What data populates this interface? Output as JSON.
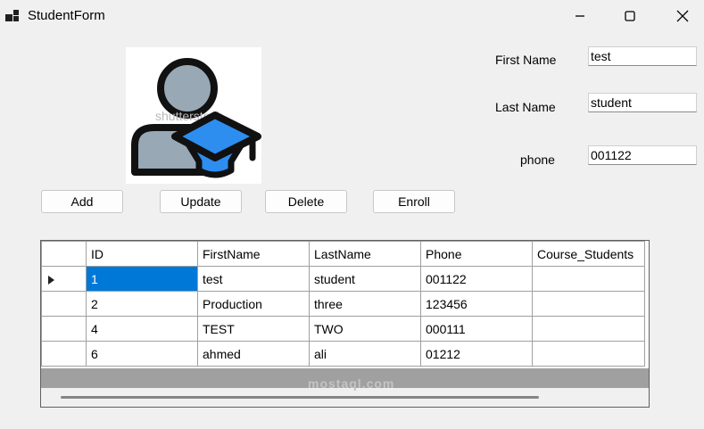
{
  "window": {
    "title": "StudentForm"
  },
  "photo": {
    "icon": "student-graduate-icon",
    "watermark": "shutterstock"
  },
  "form": {
    "first_name_label": "First Name",
    "first_name_value": "test",
    "last_name_label": "Last Name",
    "last_name_value": "student",
    "phone_label": "phone",
    "phone_value": "001122"
  },
  "buttons": {
    "add": "Add",
    "update": "Update",
    "delete": "Delete",
    "enroll": "Enroll"
  },
  "grid": {
    "columns": [
      "ID",
      "FirstName",
      "LastName",
      "Phone",
      "Course_Students"
    ],
    "rows": [
      {
        "id": "1",
        "first": "test",
        "last": "student",
        "phone": "001122",
        "course": ""
      },
      {
        "id": "2",
        "first": "Production",
        "last": "three",
        "phone": "123456",
        "course": ""
      },
      {
        "id": "4",
        "first": "TEST",
        "last": "TWO",
        "phone": "000111",
        "course": ""
      },
      {
        "id": "6",
        "first": "ahmed",
        "last": "ali",
        "phone": "01212",
        "course": ""
      }
    ],
    "selected_row": 0
  },
  "watermark": "mostaql.com",
  "colors": {
    "selection": "#0078d7",
    "cap": "#2d8ef0"
  }
}
